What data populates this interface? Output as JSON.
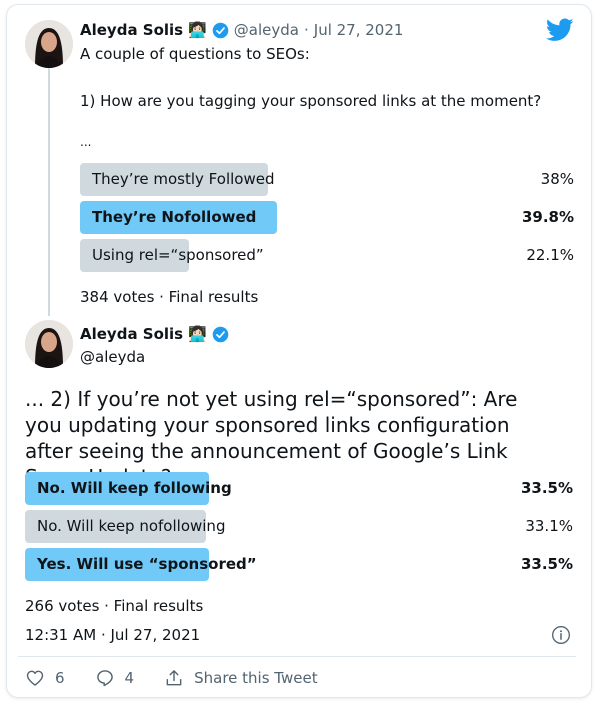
{
  "tweet1": {
    "author_name": "Aleyda Solis",
    "author_emoji": "👩🏻‍💻",
    "handle": "@aleyda",
    "separator": "·",
    "date": "Jul 27, 2021",
    "intro": "A couple of questions to SEOs:",
    "question": "1) How are you tagging your sponsored links at the moment?",
    "ellipsis": "...",
    "poll": {
      "options": [
        {
          "label": "They’re mostly Followed",
          "percent_text": "38%",
          "percent": 38,
          "winner": false
        },
        {
          "label": "They’re Nofollowed",
          "percent_text": "39.8%",
          "percent": 39.8,
          "winner": true
        },
        {
          "label": "Using rel=“sponsored”",
          "percent_text": "22.1%",
          "percent": 22.1,
          "winner": false
        }
      ],
      "summary": "384 votes · Final results"
    }
  },
  "tweet2": {
    "author_name": "Aleyda Solis",
    "author_emoji": "👩🏻‍💻",
    "handle": "@aleyda",
    "text": "... 2) If you’re not yet using rel=“sponsored”: Are you updating your sponsored links configuration after seeing the announcement of Google’s Link Spam Update?",
    "poll": {
      "options": [
        {
          "label": "No. Will keep following",
          "percent_text": "33.5%",
          "percent": 33.5,
          "winner": true
        },
        {
          "label": "No. Will keep nofollowing",
          "percent_text": "33.1%",
          "percent": 33.1,
          "winner": false
        },
        {
          "label": "Yes. Will use “sponsored”",
          "percent_text": "33.5%",
          "percent": 33.5,
          "winner": true
        }
      ],
      "summary": "266 votes · Final results"
    },
    "timestamp": "12:31 AM · Jul 27, 2021"
  },
  "actions": {
    "likes": "6",
    "replies": "4",
    "share_label": "Share this Tweet"
  },
  "colors": {
    "brand": "#1d9bf0",
    "winner_bar": "#71c9f8",
    "other_bar": "#cfd9de"
  }
}
